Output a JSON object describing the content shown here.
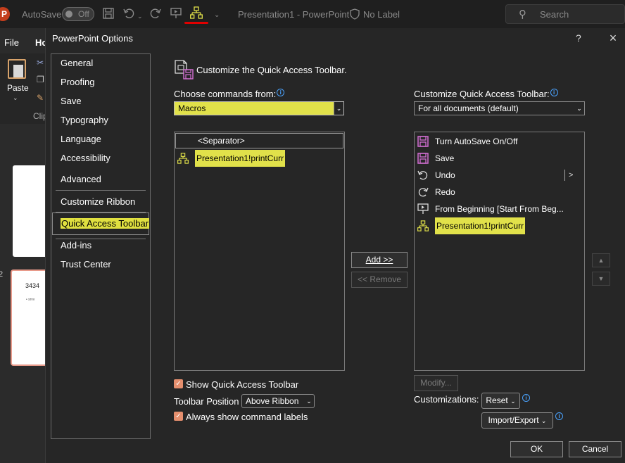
{
  "titlebar": {
    "logo": "P",
    "autosave_label": "AutoSave",
    "autosave_toggle": "Off",
    "window_title": "Presentation1  -  PowerPoint",
    "sensitivity_label": "No Label",
    "search_placeholder": "Search"
  },
  "ribbon": {
    "file_tab": "File",
    "home_tab": "Ho",
    "paste_label": "Paste",
    "clipboard_group": "Clip"
  },
  "thumbnails": {
    "slide2_number": "2",
    "slide2_title": "3434",
    "slide2_bullet": "• srvv"
  },
  "dialog": {
    "title": "PowerPoint Options",
    "help_label": "?",
    "close_label": "×",
    "nav": {
      "items": [
        "General",
        "Proofing",
        "Save",
        "Typography",
        "Language",
        "Accessibility",
        "Advanced",
        "Customize Ribbon",
        "Quick Access Toolbar",
        "Add-ins",
        "Trust Center"
      ],
      "selected": "Quick Access Toolbar"
    },
    "header_text": "Customize the Quick Access Toolbar.",
    "choose_commands_label": "Choose commands from:",
    "choose_commands_value": "Macros",
    "customize_qat_label": "Customize Quick Access Toolbar:",
    "customize_qat_value": "For all documents (default)",
    "commands_list": {
      "separator": "<Separator>",
      "items": [
        "Presentation1!printCurr"
      ]
    },
    "qat_list": {
      "items": [
        "Turn AutoSave On/Off",
        "Save",
        "Undo",
        "Redo",
        "From Beginning [Start From Beg...",
        "Presentation1!printCurr"
      ],
      "undo_expander": ">"
    },
    "add_button": "Add >>",
    "remove_button": "<< Remove",
    "modify_button": "Modify...",
    "show_qat_label": "Show Quick Access Toolbar",
    "toolbar_position_label": "Toolbar Position",
    "toolbar_position_value": "Above Ribbon",
    "always_show_labels": "Always show command labels",
    "customizations_label": "Customizations:",
    "reset_button": "Reset",
    "import_export_button": "Import/Export",
    "ok_button": "OK",
    "cancel_button": "Cancel"
  },
  "colors": {
    "highlight": "#e1e14a",
    "accent_checkbox": "#e58f6e",
    "title_underline": "#e00000",
    "save_icon": "#d36fd3",
    "macro_icon": "#e1e14a",
    "info_icon": "#4aa3ff"
  }
}
